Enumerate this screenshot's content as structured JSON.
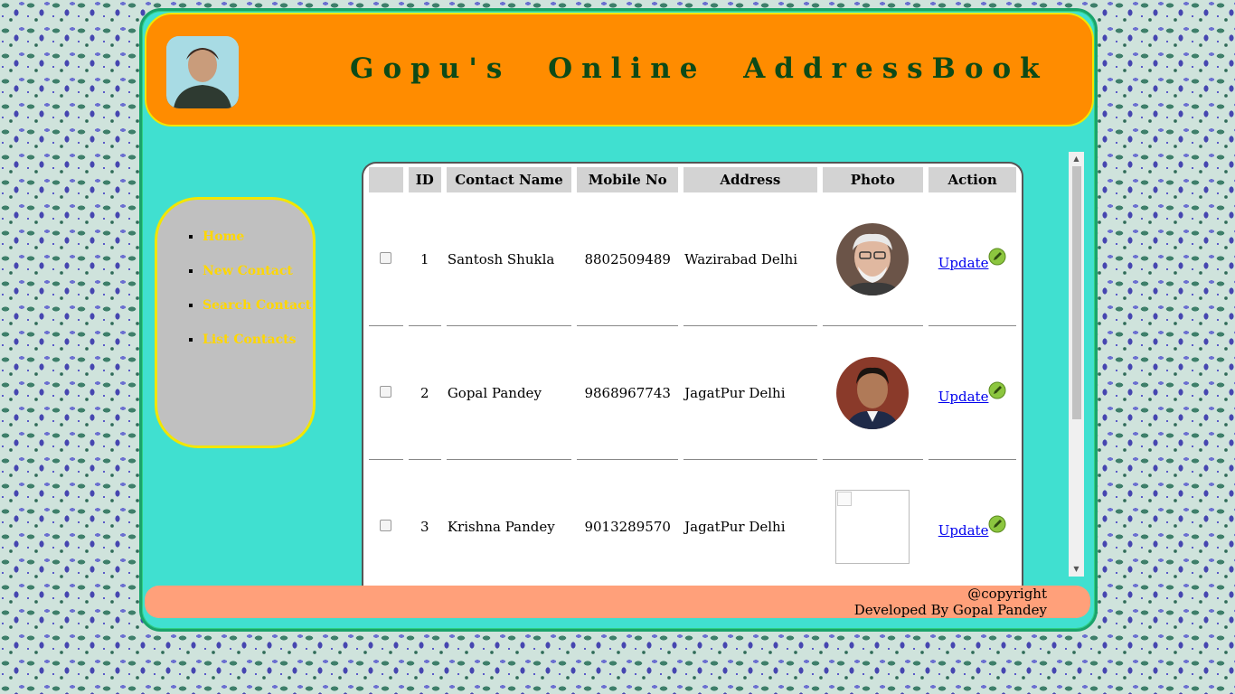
{
  "header": {
    "title": "Gopu's Online AddressBook"
  },
  "nav": {
    "items": [
      {
        "label": "Home"
      },
      {
        "label": "New Contact"
      },
      {
        "label": "Search Contact"
      },
      {
        "label": "List Contacts"
      }
    ]
  },
  "table": {
    "headers": [
      "",
      "ID",
      "Contact Name",
      "Mobile No",
      "Address",
      "Photo",
      "Action"
    ],
    "rows": [
      {
        "id": "1",
        "name": "Santosh Shukla",
        "mobile": "8802509489",
        "address": "Wazirabad Delhi",
        "action": "Update"
      },
      {
        "id": "2",
        "name": "Gopal Pandey",
        "mobile": "9868967743",
        "address": "JagatPur Delhi",
        "action": "Update"
      },
      {
        "id": "3",
        "name": "Krishna Pandey",
        "mobile": "9013289570",
        "address": "JagatPur Delhi",
        "action": "Update"
      }
    ]
  },
  "footer": {
    "line1": "@copyright",
    "line2": "Developed By Gopal Pandey"
  },
  "colors": {
    "header_bg": "#ff8c00",
    "frame_bg": "#40e0d0",
    "nav_link": "#ffd700",
    "title_color": "#0d4a17",
    "footer_bg": "#ffa07a"
  },
  "icons": {
    "edit": "pencil-edit-icon"
  }
}
